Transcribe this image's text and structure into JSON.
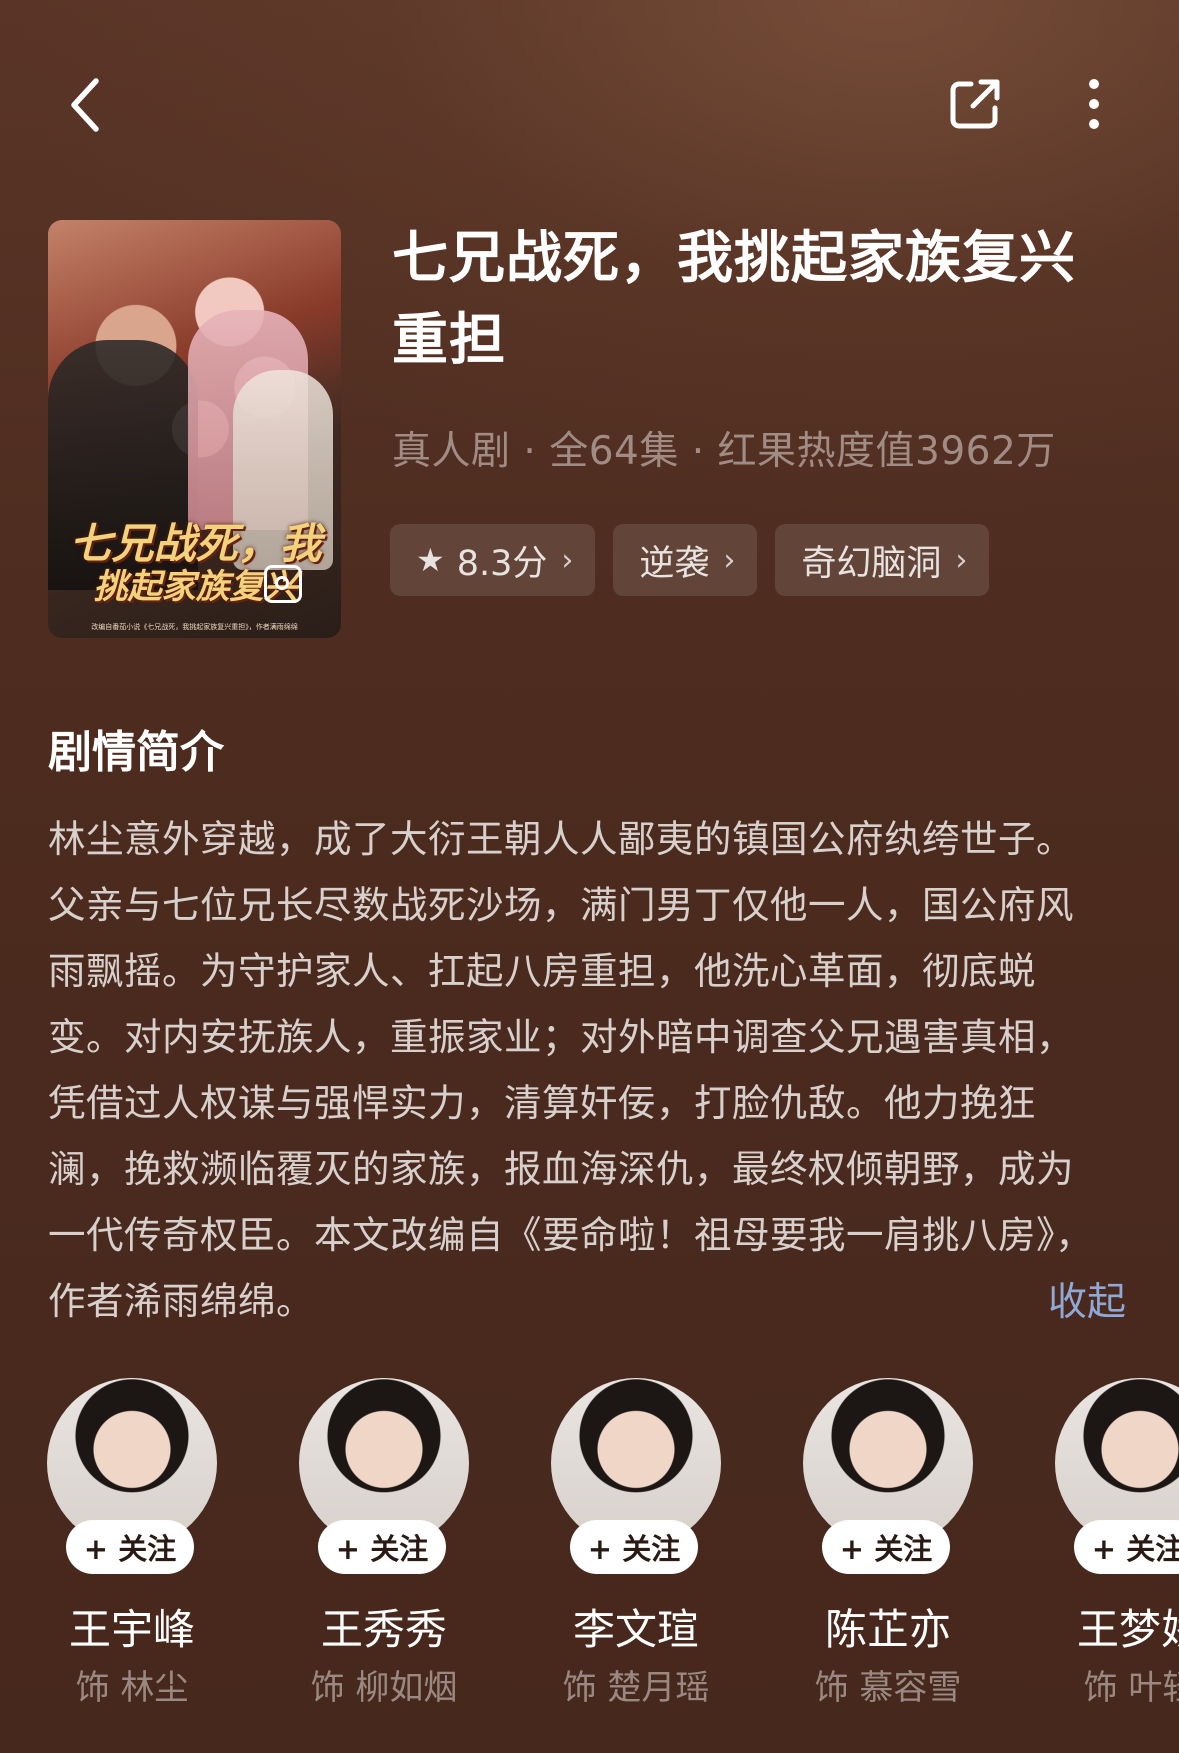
{
  "header": {
    "back_icon": "chevron-left-icon",
    "share_icon": "share-icon",
    "more_icon": "more-vertical-icon"
  },
  "poster": {
    "title_line1": "七兄战死，我",
    "title_line2": "挑起家族复兴",
    "note": "改编自番茄小说《七兄战死，我挑起家族复兴重担》，作者满雨绵绵"
  },
  "drama": {
    "title": "七兄战死，我挑起家族复兴重担",
    "meta": "真人剧 · 全64集 · 红果热度值3962万",
    "tags": [
      {
        "label": "8.3分",
        "icon": "star-icon"
      },
      {
        "label": "逆袭"
      },
      {
        "label": "奇幻脑洞"
      }
    ]
  },
  "synopsis": {
    "heading": "剧情简介",
    "text": "林尘意外穿越，成了大衍王朝人人鄙夷的镇国公府纨绔世子。父亲与七位兄长尽数战死沙场，满门男丁仅他一人，国公府风雨飘摇。为守护家人、扛起八房重担，他洗心革面，彻底蜕变。对内安抚族人，重振家业；对外暗中调查父兄遇害真相，凭借过人权谋与强悍实力，清算奸佞，打脸仇敌。他力挽狂澜，挽救濒临覆灭的家族，报血海深仇，最终权倾朝野，成为一代传奇权臣。本文改编自《要命啦！祖母要我一肩挑八房》，作者浠雨绵绵。",
    "collapse_label": "收起"
  },
  "cast": [
    {
      "name": "王宇峰",
      "role": "饰 林尘",
      "follow": "+ 关注"
    },
    {
      "name": "王秀秀",
      "role": "饰 柳如烟",
      "follow": "+ 关注"
    },
    {
      "name": "李文瑄",
      "role": "饰 楚月瑶",
      "follow": "+ 关注"
    },
    {
      "name": "陈芷亦",
      "role": "饰 慕容雪",
      "follow": "+ 关注"
    },
    {
      "name": "王梦娇",
      "role": "饰 叶轻",
      "follow": "+ 关注"
    }
  ]
}
